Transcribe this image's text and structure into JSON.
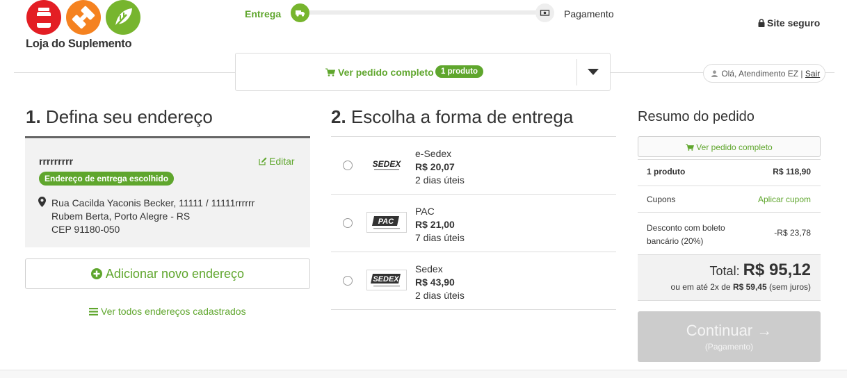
{
  "brand": {
    "name": "Loja do Suplemento"
  },
  "steps": {
    "current": "Entrega",
    "next": "Pagamento"
  },
  "secure": {
    "label": "Site seguro"
  },
  "order_toggle": {
    "label": "Ver pedido completo",
    "badge": "1 produto"
  },
  "user": {
    "greeting": "Olá, Atendimento EZ",
    "separator": "|",
    "logout": "Sair"
  },
  "address_section": {
    "number": "1.",
    "title": "Defina seu endereço",
    "name": "rrrrrrrrr",
    "edit_label": "Editar",
    "chosen_badge": "Endereço de entrega escolhido",
    "line1": "Rua Cacilda Yaconis Becker, 11111 / 11111rrrrrr",
    "line2": "Rubem Berta, Porto Alegre - RS",
    "line3": "CEP 91180-050",
    "add_button": "Adicionar novo endereço",
    "view_all": "Ver todos endereços cadastrados"
  },
  "shipping_section": {
    "number": "2.",
    "title": "Escolha a forma de entrega",
    "options": [
      {
        "logo": "SEDEX",
        "name": "e-Sedex",
        "price": "R$ 20,07",
        "days": "2 dias úteis"
      },
      {
        "logo": "PAC",
        "name": "PAC",
        "price": "R$ 21,00",
        "days": "7 dias úteis"
      },
      {
        "logo": "SEDEX",
        "name": "Sedex",
        "price": "R$ 43,90",
        "days": "2 dias úteis"
      }
    ]
  },
  "summary": {
    "title": "Resumo do pedido",
    "view_button": "Ver pedido completo",
    "products_label": "1 produto",
    "products_value": "R$ 118,90",
    "coupons_label": "Cupons",
    "coupons_action": "Aplicar cupom",
    "discount_label_1": "Desconto com boleto",
    "discount_label_2": "bancário (20%)",
    "discount_value": "-R$ 23,78",
    "total_label": "Total:",
    "total_value": "R$ 95,12",
    "installments_prefix": "ou em até 2x de",
    "installments_value": "R$ 59,45",
    "installments_suffix": "(sem juros)"
  },
  "continue_button": {
    "label": "Continuar →",
    "sub": "(Pagamento)"
  },
  "colors": {
    "green": "#5fa62d",
    "red": "#e31e24",
    "orange": "#f58220",
    "disabled": "#cccccc"
  }
}
